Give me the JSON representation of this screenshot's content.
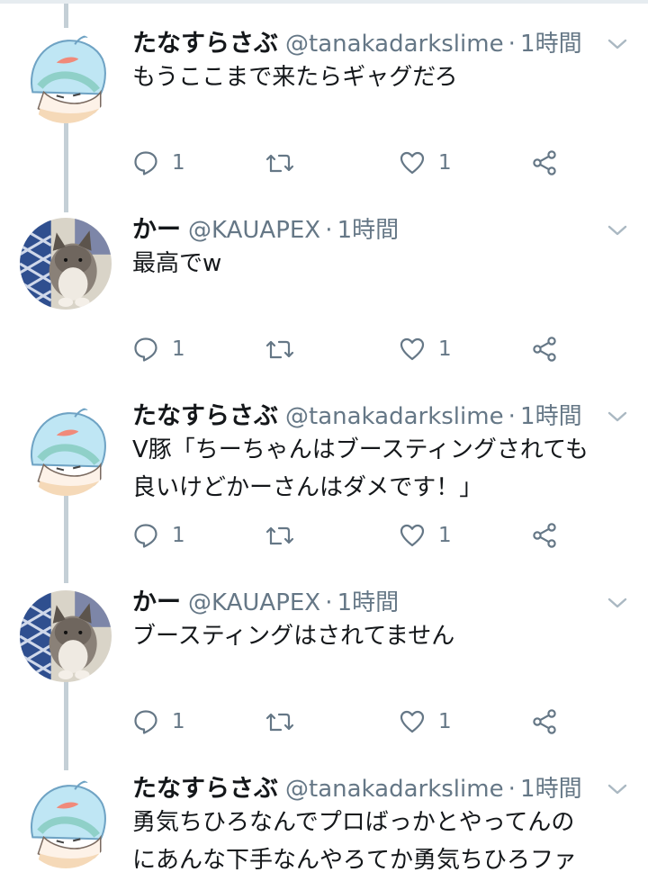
{
  "tweets": [
    {
      "name": "たなすらさぶ",
      "handle": "@tanakadarkslime",
      "separator": "·",
      "time": "1時間",
      "text": "もうここまで来たらギャグだろ",
      "avatar_icon": "slime-character-avatar",
      "reply_count": "1",
      "retweet_count": "",
      "like_count": "1"
    },
    {
      "name": "かー",
      "handle": "@KAUAPEX",
      "separator": "·",
      "time": "1時間",
      "text": "最高でw",
      "avatar_icon": "cat-photo-avatar",
      "reply_count": "1",
      "retweet_count": "",
      "like_count": "1"
    },
    {
      "name": "たなすらさぶ",
      "handle": "@tanakadarkslime",
      "separator": "·",
      "time": "1時間",
      "text": "V豚「ちーちゃんはブースティングされても\n良いけどかーさんはダメです！」",
      "avatar_icon": "slime-character-avatar",
      "reply_count": "1",
      "retweet_count": "",
      "like_count": "1"
    },
    {
      "name": "かー",
      "handle": "@KAUAPEX",
      "separator": "·",
      "time": "1時間",
      "text": "ブースティングはされてません",
      "avatar_icon": "cat-photo-avatar",
      "reply_count": "1",
      "retweet_count": "",
      "like_count": "1"
    },
    {
      "name": "たなすらさぶ",
      "handle": "@tanakadarkslime",
      "separator": "·",
      "time": "1時間",
      "text": "勇気ちひろなんでプロばっかとやってんの\nにあんな下手なんやろてか勇気ちひろファ",
      "avatar_icon": "slime-character-avatar",
      "reply_count": "",
      "retweet_count": "",
      "like_count": ""
    }
  ],
  "colors": {
    "text": "#14171a",
    "secondary": "#657786",
    "thread_line": "#c4cfd6",
    "divider": "#e6ecf0"
  }
}
